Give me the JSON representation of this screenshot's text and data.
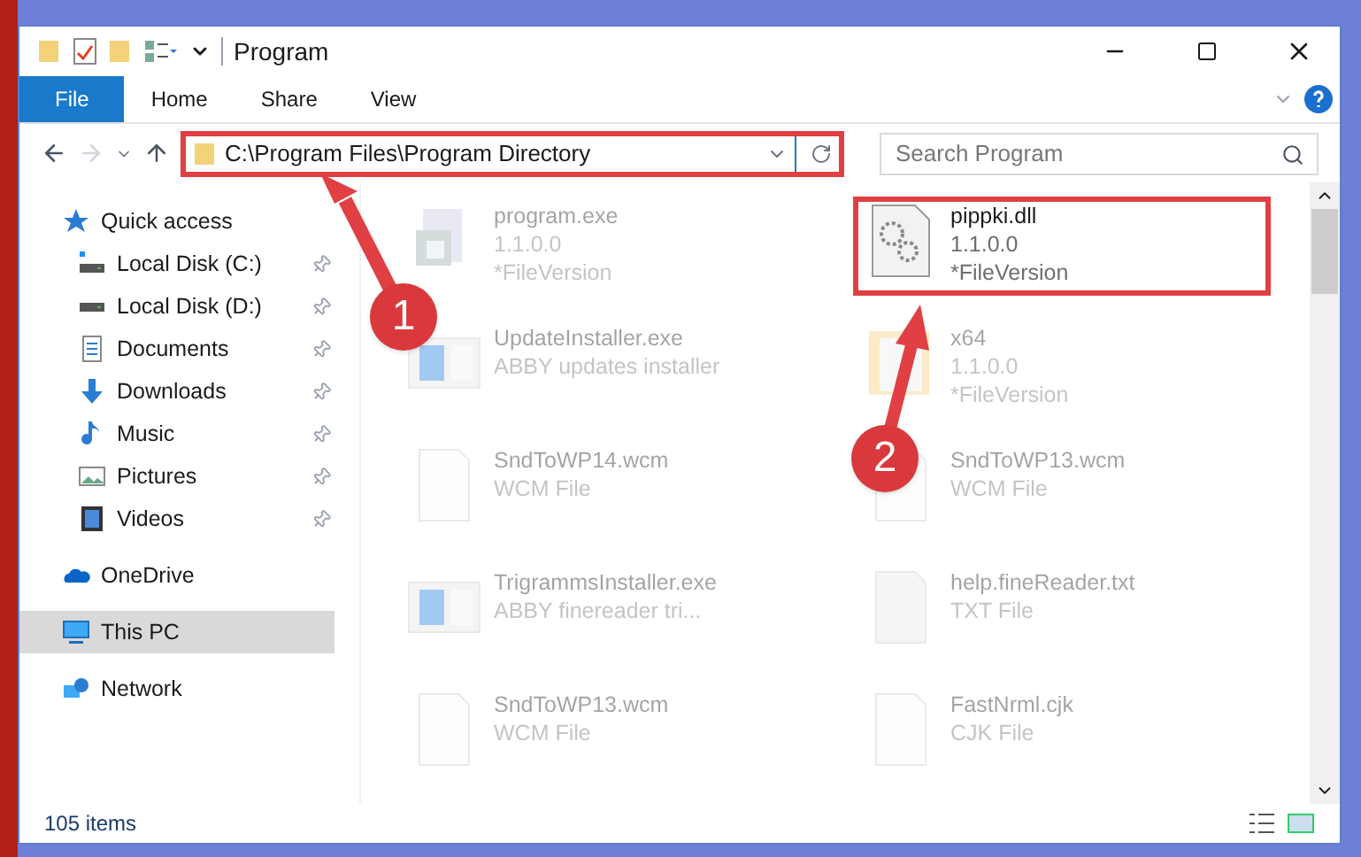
{
  "window": {
    "title": "Program"
  },
  "ribbon_tabs": [
    {
      "label": "File",
      "selected": true
    },
    {
      "label": "Home",
      "selected": false
    },
    {
      "label": "Share",
      "selected": false
    },
    {
      "label": "View",
      "selected": false
    }
  ],
  "address": {
    "path": "C:\\Program Files\\Program Directory",
    "highlighted": true
  },
  "search": {
    "placeholder": "Search Program"
  },
  "nav_pane": [
    {
      "label": "Quick access",
      "kind": "star",
      "pinned": false,
      "selected": false,
      "group": true
    },
    {
      "label": "Local Disk (C:)",
      "kind": "drive-c",
      "pinned": true,
      "selected": false,
      "group": false
    },
    {
      "label": "Local Disk (D:)",
      "kind": "drive",
      "pinned": true,
      "selected": false,
      "group": false
    },
    {
      "label": "Documents",
      "kind": "documents",
      "pinned": true,
      "selected": false,
      "group": false
    },
    {
      "label": "Downloads",
      "kind": "downloads",
      "pinned": true,
      "selected": false,
      "group": false
    },
    {
      "label": "Music",
      "kind": "music",
      "pinned": true,
      "selected": false,
      "group": false
    },
    {
      "label": "Pictures",
      "kind": "pictures",
      "pinned": true,
      "selected": false,
      "group": false
    },
    {
      "label": "Videos",
      "kind": "videos",
      "pinned": true,
      "selected": false,
      "group": false
    },
    {
      "label": "OneDrive",
      "kind": "cloud",
      "pinned": false,
      "selected": false,
      "group": true
    },
    {
      "label": "This PC",
      "kind": "pc",
      "pinned": false,
      "selected": true,
      "group": true
    },
    {
      "label": "Network",
      "kind": "network",
      "pinned": false,
      "selected": false,
      "group": true
    }
  ],
  "files": [
    {
      "name": "program.exe",
      "details": [
        "1.1.0.0",
        "*FileVersion"
      ],
      "kind": "exe",
      "highlighted": false,
      "dimmed": true
    },
    {
      "name": "pippki.dll",
      "details": [
        "1.1.0.0",
        "*FileVersion"
      ],
      "kind": "settings",
      "highlighted": true,
      "dimmed": false
    },
    {
      "name": "UpdateInstaller.exe",
      "details": [
        "ABBY updates installer"
      ],
      "kind": "installer",
      "highlighted": false,
      "dimmed": true
    },
    {
      "name": "x64",
      "details": [
        "1.1.0.0",
        "*FileVersion"
      ],
      "kind": "folder",
      "highlighted": false,
      "dimmed": true
    },
    {
      "name": "SndToWP14.wcm",
      "details": [
        "WCM File"
      ],
      "kind": "document",
      "highlighted": false,
      "dimmed": true
    },
    {
      "name": "SndToWP13.wcm",
      "details": [
        "WCM File"
      ],
      "kind": "document",
      "highlighted": false,
      "dimmed": true
    },
    {
      "name": "TrigrammsInstaller.exe",
      "details": [
        "ABBY finereader tri..."
      ],
      "kind": "installer",
      "highlighted": false,
      "dimmed": true
    },
    {
      "name": "help.fineReader.txt",
      "details": [
        "TXT File"
      ],
      "kind": "text",
      "highlighted": false,
      "dimmed": true
    },
    {
      "name": "SndToWP13.wcm",
      "details": [
        "WCM File"
      ],
      "kind": "document",
      "highlighted": false,
      "dimmed": true
    },
    {
      "name": "FastNrml.cjk",
      "details": [
        "CJK File"
      ],
      "kind": "document",
      "highlighted": false,
      "dimmed": true
    }
  ],
  "annotations": [
    {
      "number": "1"
    },
    {
      "number": "2"
    }
  ],
  "status_bar": {
    "text": "105 items"
  }
}
